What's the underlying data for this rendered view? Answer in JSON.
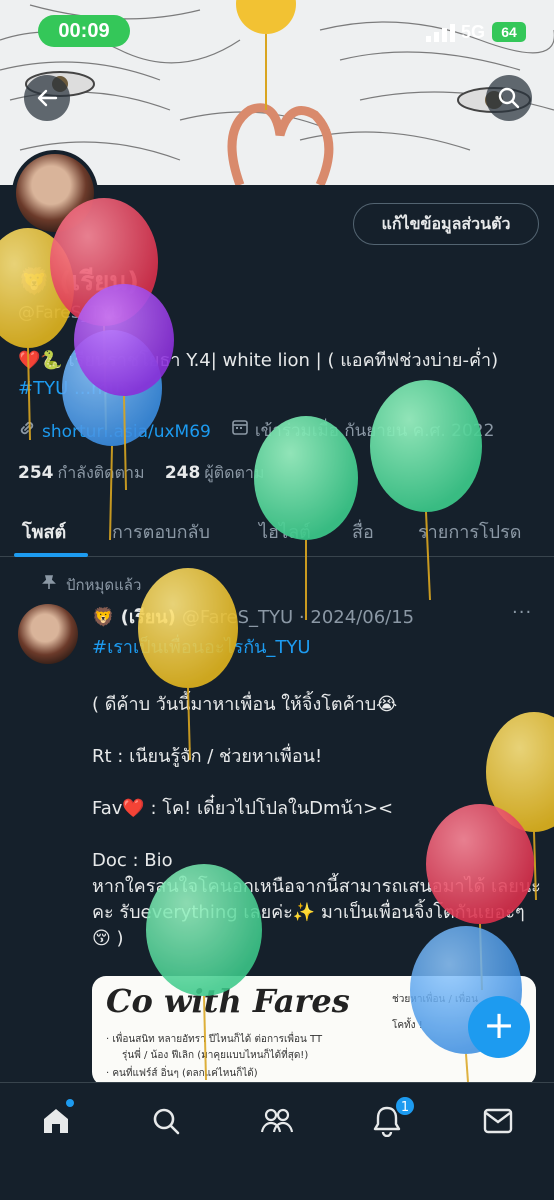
{
  "status_bar": {
    "time": "00:09",
    "network": "5G",
    "battery": "64"
  },
  "profile": {
    "edit_button": "แก้ไขข้อมูลส่วนตัว",
    "name": "🦁 (เรียน)",
    "handle": "@FareS_TYU",
    "bio_text": "❤️🐍 เรียนราชโยธา Y.4| white lion | ( แอคทีฟช่วงบ่าย-ค่ำ) ",
    "bio_tag": "#TYU ...mu",
    "link": "shorturl.asia/uxM69",
    "joined": "เข้าร่วมเมื่อ กันยายน ค.ศ. 2022",
    "following_count": "254",
    "following_label": "กำลังติดตาม",
    "followers_count": "248",
    "followers_label": "ผู้ติดตาม"
  },
  "tabs": [
    "โพสต์",
    "การตอบกลับ",
    "ไฮไลต์",
    "สื่อ",
    "รายการโปรด"
  ],
  "post": {
    "pinned_label": "ปักหมุดแล้ว",
    "name": "🦁 (เรียน)",
    "meta": "@FareS_TYU · 2024/06/15",
    "more": "···",
    "hashtag": "#เราเป็นเพื่อนอะไรกัน_TYU",
    "body": "( ดีค้าบ วันนี้มาหาเพื่อน ให้จิ้งโตค้าบ😭\n\nRt : เนียนรู้จัก / ช่วยหาเพื่อน!\n\nFav❤️ : โค! เดี๋ยวไปโปลในDmน้า><\n\nDoc : Bio\nหากใครสนใจโคนอกเหนือจากนี้สามารถเสนอมาได้ เลยนะคะ รับeverything เลยค่ะ✨ มาเป็นเพื่อนจิ้งโตกันเยอะๆ😚 )",
    "media_title": "Co with Fares",
    "media_lines": [
      "· เพื่อนสนิท  หลายอัทรา ปีไหนก็ได้  ต่อการเพื่อน TT",
      "รุ่นพี่ / น้อง ฟีเลิก (มาคุยแบบไหนก็ได้ที่สุด!)",
      "· คนที่แฟร์ส์ อิ่นๆ (ตลกแค่ไหนก็ได้)",
      "ช่วยหาเพื่อน / เพื่อน",
      "โคทั้ง !"
    ]
  },
  "fab_label": "+",
  "nav": {
    "notification_count": "1"
  },
  "colors": {
    "background": "#15202b",
    "accent": "#1d9bf0",
    "status_green": "#34c759"
  }
}
